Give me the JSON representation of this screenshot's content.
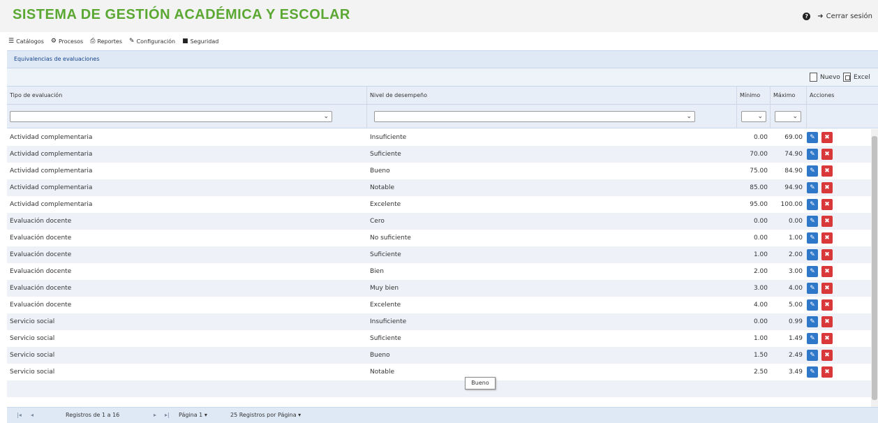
{
  "app": {
    "title": "SISTEMA DE GESTIÓN ACADÉMICA Y ESCOLAR",
    "logout_label": "Cerrar sesión"
  },
  "menu": [
    {
      "icon": "list-icon",
      "label": "Catálogos"
    },
    {
      "icon": "gear-icon",
      "label": "Procesos"
    },
    {
      "icon": "print-icon",
      "label": "Reportes"
    },
    {
      "icon": "wrench-icon",
      "label": "Configuración"
    },
    {
      "icon": "lock-icon",
      "label": "Seguridad"
    }
  ],
  "panel": {
    "title": "Equivalencias de evaluaciones",
    "new_label": "Nuevo",
    "excel_label": "Excel"
  },
  "columns": {
    "tipo": "Tipo de evaluación",
    "nivel": "Nivel de desempeño",
    "min": "Mínimo",
    "max": "Máximo",
    "acciones": "Acciones"
  },
  "rows": [
    {
      "tipo": "Actividad complementaria",
      "nivel": "Insuficiente",
      "min": "0.00",
      "max": "69.00"
    },
    {
      "tipo": "Actividad complementaria",
      "nivel": "Suficiente",
      "min": "70.00",
      "max": "74.90"
    },
    {
      "tipo": "Actividad complementaria",
      "nivel": "Bueno",
      "min": "75.00",
      "max": "84.90"
    },
    {
      "tipo": "Actividad complementaria",
      "nivel": "Notable",
      "min": "85.00",
      "max": "94.90"
    },
    {
      "tipo": "Actividad complementaria",
      "nivel": "Excelente",
      "min": "95.00",
      "max": "100.00"
    },
    {
      "tipo": "Evaluación docente",
      "nivel": "Cero",
      "min": "0.00",
      "max": "0.00"
    },
    {
      "tipo": "Evaluación docente",
      "nivel": "No suficiente",
      "min": "0.00",
      "max": "1.00"
    },
    {
      "tipo": "Evaluación docente",
      "nivel": "Suficiente",
      "min": "1.00",
      "max": "2.00"
    },
    {
      "tipo": "Evaluación docente",
      "nivel": "Bien",
      "min": "2.00",
      "max": "3.00"
    },
    {
      "tipo": "Evaluación docente",
      "nivel": "Muy bien",
      "min": "3.00",
      "max": "4.00"
    },
    {
      "tipo": "Evaluación docente",
      "nivel": "Excelente",
      "min": "4.00",
      "max": "5.00"
    },
    {
      "tipo": "Servicio social",
      "nivel": "Insuficiente",
      "min": "0.00",
      "max": "0.99"
    },
    {
      "tipo": "Servicio social",
      "nivel": "Suficiente",
      "min": "1.00",
      "max": "1.49"
    },
    {
      "tipo": "Servicio social",
      "nivel": "Bueno",
      "min": "1.50",
      "max": "2.49"
    },
    {
      "tipo": "Servicio social",
      "nivel": "Notable",
      "min": "2.50",
      "max": "3.49"
    }
  ],
  "tooltip": "Bueno",
  "footer": {
    "records": "Registros de 1 a 16",
    "page": "Página 1",
    "per_page": "25 Registros por Página"
  }
}
